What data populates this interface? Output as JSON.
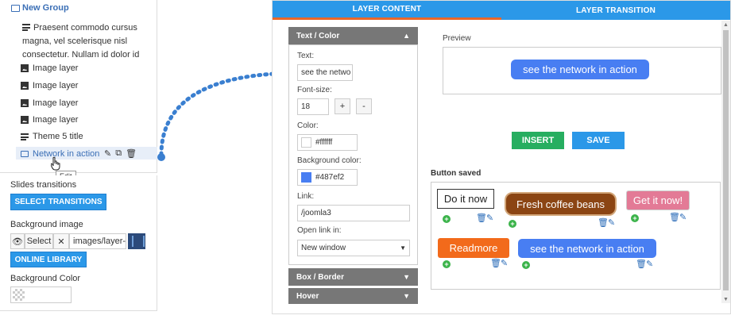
{
  "tree": {
    "group_label": "New Group",
    "description": "Praesent commodo cursus magna, vel scelerisque nisl consectetur. Nullam id dolor id",
    "items": [
      {
        "label": "Image layer",
        "icon": "image-icon"
      },
      {
        "label": "Image layer",
        "icon": "image-icon"
      },
      {
        "label": "Image layer",
        "icon": "image-icon"
      },
      {
        "label": "Image layer",
        "icon": "image-icon"
      },
      {
        "label": "Theme 5 title",
        "icon": "text-icon"
      }
    ],
    "active_item": {
      "label": "Network in action",
      "icon": "button-icon"
    },
    "tooltip": "Edit"
  },
  "settings": {
    "slides_transitions_label": "Slides transitions",
    "select_transitions_label": "SELECT TRANSITIONS",
    "background_image_label": "Background image",
    "select_label": "Select",
    "bg_path": "images/layer-s",
    "online_library_label": "ONLINE LIBRARY",
    "background_color_label": "Background Color"
  },
  "tabs": {
    "layer_content": "LAYER CONTENT",
    "layer_transition": "LAYER TRANSITION"
  },
  "accordion": {
    "text_color_title": "Text / Color",
    "text_label": "Text:",
    "text_value": "see the netwo",
    "font_size_label": "Font-size:",
    "font_size_value": "18",
    "plus": "+",
    "minus": "-",
    "color_label": "Color:",
    "color_value": "#ffffff",
    "bg_color_label": "Background color:",
    "bg_color_value": "#487ef2",
    "link_label": "Link:",
    "link_value": "/joomla3",
    "open_link_label": "Open link in:",
    "open_link_value": "New window",
    "box_border_title": "Box / Border",
    "hover_title": "Hover"
  },
  "preview": {
    "label": "Preview",
    "button_text": "see the network in action",
    "insert_label": "INSERT",
    "save_label": "SAVE"
  },
  "saved": {
    "label": "Button saved",
    "buttons": [
      {
        "text": "Do it now"
      },
      {
        "text": "Fresh coffee beans"
      },
      {
        "text": "Get it now!"
      },
      {
        "text": "Readmore"
      },
      {
        "text": "see the network in action"
      }
    ]
  },
  "colors": {
    "accent": "#2b98e8",
    "tab_underline": "#e9672a",
    "insert": "#27ae60",
    "preview_bg": "#487ef2"
  }
}
